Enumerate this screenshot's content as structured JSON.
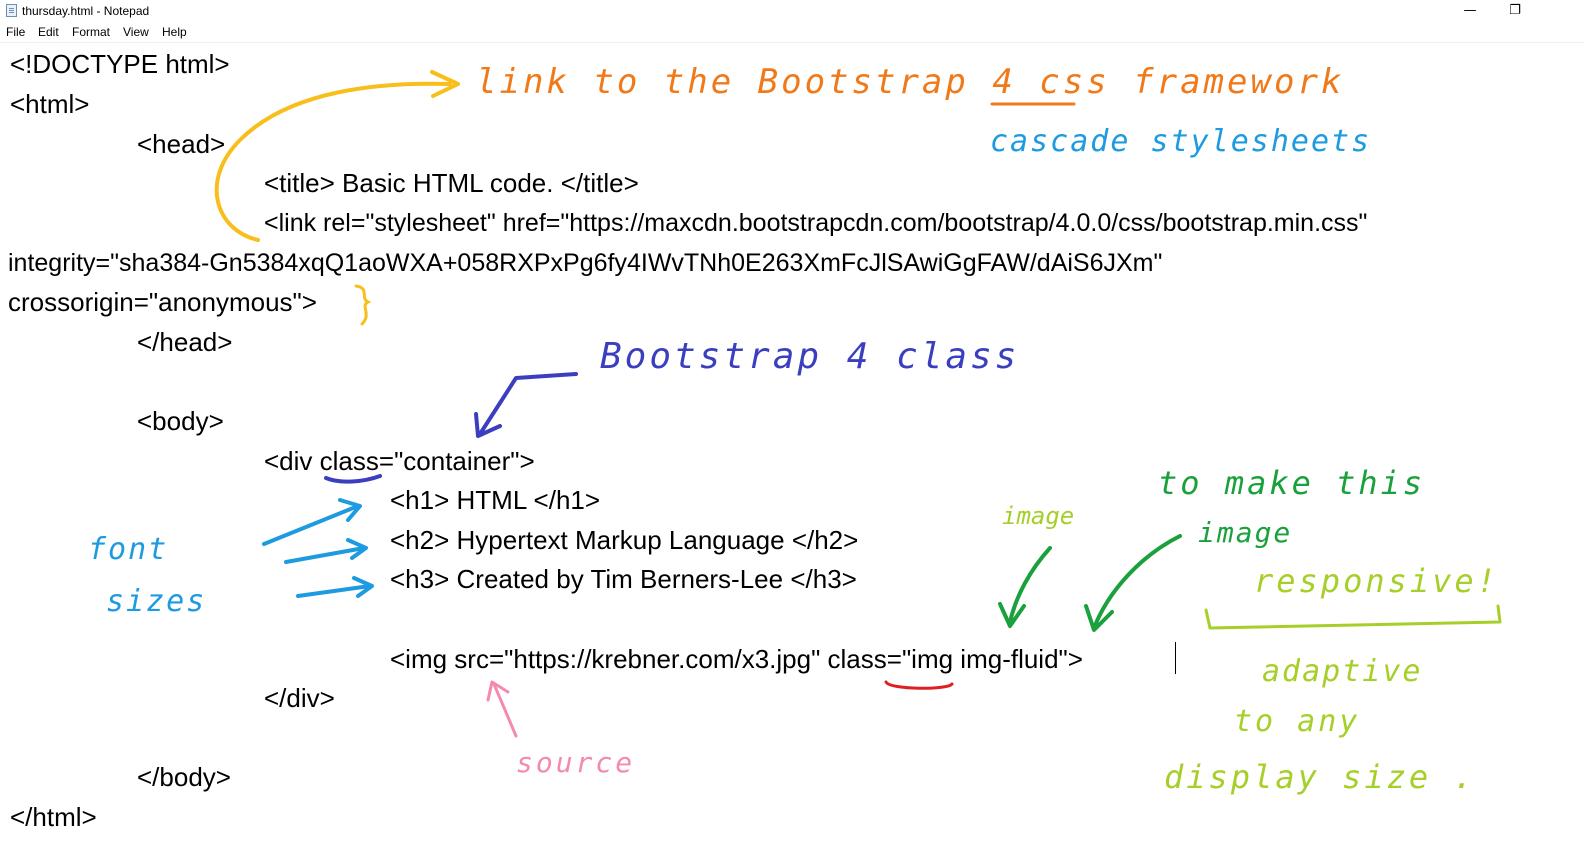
{
  "window": {
    "title": "thursday.html - Notepad",
    "minimize_glyph": "—",
    "restore_glyph": "❐"
  },
  "menu": {
    "items": [
      {
        "label": "File"
      },
      {
        "label": "Edit"
      },
      {
        "label": "Format"
      },
      {
        "label": "View"
      },
      {
        "label": "Help"
      }
    ]
  },
  "editor": {
    "lines": [
      "<!DOCTYPE html>",
      "<html>",
      "<head>",
      "<title> Basic HTML code. </title>",
      "<link rel=\"stylesheet\" href=\"https://maxcdn.bootstrapcdn.com/bootstrap/4.0.0/css/bootstrap.min.css\"",
      "integrity=\"sha384-Gn5384xqQ1aoWXA+058RXPxPg6fy4IWvTNh0E263XmFcJlSAwiGgFAW/dAiS6JXm\"",
      "crossorigin=\"anonymous\">",
      "</head>",
      "<body>",
      "<div class=\"container\">",
      "<h1> HTML </h1>",
      "<h2> Hypertext Markup Language </h2>",
      "<h3> Created by Tim Berners-Lee </h3>",
      "<img src=\"https://krebner.com/x3.jpg\" class=\"img img-fluid\">",
      "</div>",
      "</body>",
      "</html>"
    ]
  },
  "annotations": {
    "link_note": "link to the Bootstrap 4 css framework",
    "css_note": "cascade stylesheets",
    "class_note": "Bootstrap 4 class",
    "font_sizes_line1": "font",
    "font_sizes_line2": "sizes",
    "image_note": "image",
    "responsive_line1": "to make this",
    "responsive_line2": "image",
    "responsive_line3": "responsive!",
    "adaptive_line1": "adaptive",
    "adaptive_line2": "to any",
    "adaptive_line3": "display size .",
    "source_note": "source"
  },
  "colors": {
    "orange": "#f07a1a",
    "yellow": "#f7be1c",
    "blue_light": "#1e9be0",
    "blue_dark": "#3b3fbf",
    "green_dark": "#1aa03c",
    "green_light": "#a6cf2a",
    "pink": "#f28ab2",
    "red": "#e02020"
  }
}
